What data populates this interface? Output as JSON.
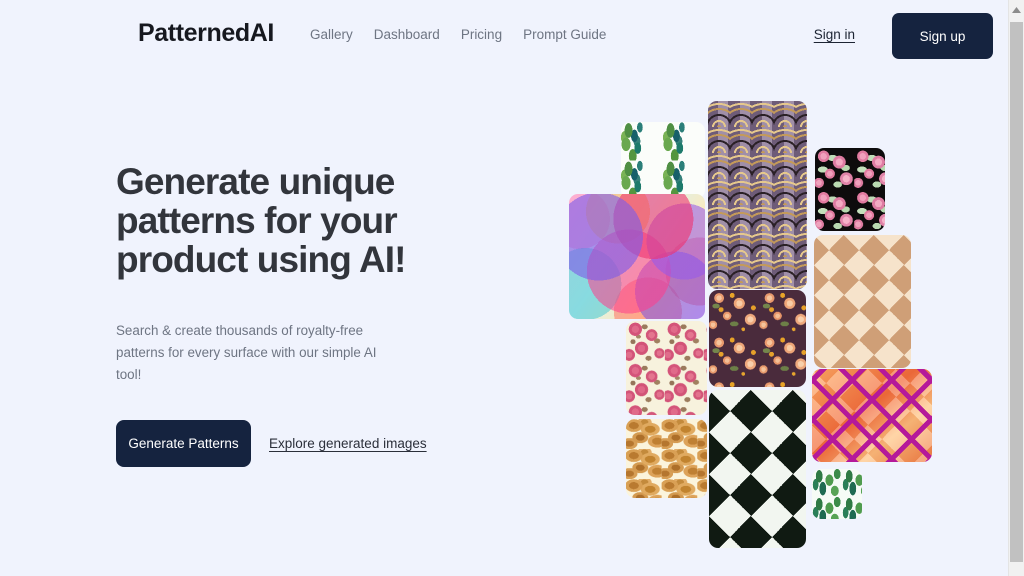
{
  "brand": {
    "name": "PatternedAI"
  },
  "nav": {
    "items": [
      {
        "label": "Gallery"
      },
      {
        "label": "Dashboard"
      },
      {
        "label": "Pricing"
      },
      {
        "label": "Prompt Guide"
      }
    ]
  },
  "auth": {
    "signin_label": "Sign in",
    "signup_label": "Sign up",
    "signup_bg": "#15233f"
  },
  "hero": {
    "heading": "Generate unique patterns for your product using AI!",
    "subtext": "Search & create thousands of royalty-free patterns for every surface with our simple AI tool!",
    "primary_cta": "Generate Patterns",
    "secondary_cta": "Explore generated images",
    "primary_cta_bg": "#15233f"
  },
  "theme": {
    "page_bg": "#f0f3fd",
    "heading_color": "#32353c",
    "muted_text": "#6e7583"
  },
  "collage": {
    "tiles": [
      {
        "name": "watercolor-leaves",
        "description": "Green and teal watercolor leaves on white"
      },
      {
        "name": "art-deco-fan",
        "description": "Purple and gold art deco fan scallop"
      },
      {
        "name": "pink-roses-black",
        "description": "Pink roses with mint leaves on black"
      },
      {
        "name": "rainbow-circles",
        "description": "Overlapping translucent rainbow circles"
      },
      {
        "name": "gold-diamond-maze",
        "description": "Beige and gold concentric diamond maze"
      },
      {
        "name": "plum-floral",
        "description": "Peach flowers on dark plum background"
      },
      {
        "name": "roses-cream",
        "description": "Pink roses on cream background"
      },
      {
        "name": "golden-pebbles",
        "description": "Golden brown pebble cluster pattern"
      },
      {
        "name": "ikat-diamonds",
        "description": "Black and white concentric ikat diamonds"
      },
      {
        "name": "magenta-lattice",
        "description": "Magenta lattice over orange gradient"
      },
      {
        "name": "green-leaves-small",
        "description": "Green leaves sprig on off-white"
      }
    ]
  },
  "scrollbar": {
    "position": "right"
  }
}
